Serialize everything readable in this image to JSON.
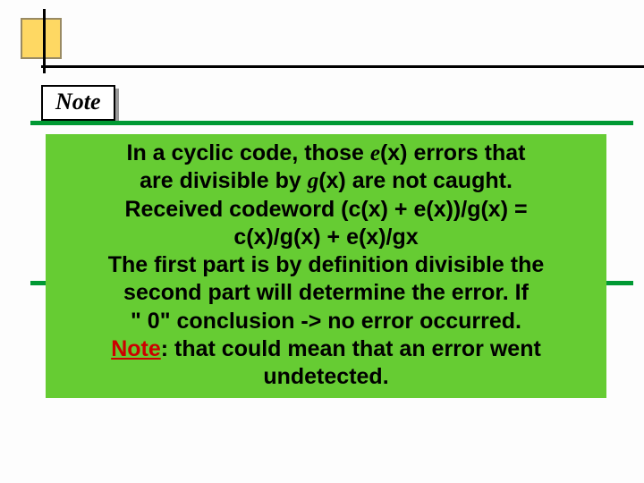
{
  "note_label": "Note",
  "body": {
    "line1_a": "In a cyclic code, those ",
    "line1_e": "e",
    "line1_b": "(x) errors that",
    "line2_a": "are divisible by ",
    "line2_g": "g",
    "line2_b": "(x) are not caught.",
    "line3": "Received codeword (c(x) + e(x))/g(x) =",
    "line4": "c(x)/g(x) + e(x)/gx",
    "line5": "The first part is by definition divisible the",
    "line6": "second part will determine the error. If",
    "line7": "\" 0\" conclusion -> no error occurred.",
    "line8_note": "Note",
    "line8_rest": ": that could mean that an error went",
    "line9": "undetected."
  }
}
